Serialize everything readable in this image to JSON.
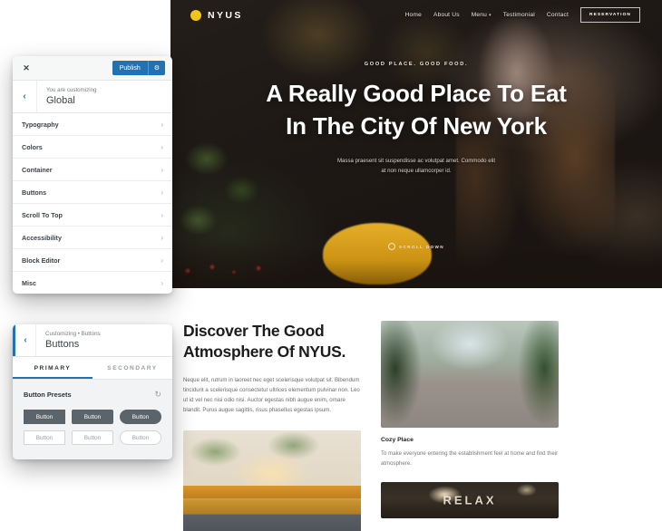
{
  "site": {
    "brand": {
      "name": "NYUS",
      "logo_icon": "circle-dot-icon",
      "logo_color": "#f0c419"
    },
    "nav": [
      {
        "label": "Home",
        "has_dropdown": false
      },
      {
        "label": "About Us",
        "has_dropdown": false
      },
      {
        "label": "Menu",
        "has_dropdown": true
      },
      {
        "label": "Testimonial",
        "has_dropdown": false
      },
      {
        "label": "Contact",
        "has_dropdown": false
      }
    ],
    "cta": {
      "label": "RESERVATION"
    },
    "hero": {
      "eyebrow": "GOOD PLACE. GOOD FOOD.",
      "title_line1": "A Really Good Place To Eat",
      "title_line2": "In The City Of New York",
      "subtitle_line1": "Massa praesent sit suspendisse ac volutpat amet. Commodo elit",
      "subtitle_line2": "at non neque ullamcorper id.",
      "scroll_label": "SCROLL DOWN",
      "scroll_icon": "mouse-scroll-icon"
    },
    "section": {
      "title_line1": "Discover The Good",
      "title_line2": "Atmosphere Of NYUS.",
      "body": "Neque elit, rutrum in laoreet nec eget scelerisque volutpat sit. Bibendum tincidunt a scelerisque consectetur ultrices elementum pulvinar non. Leo ut id vel nec nisi odio nisi. Auctor egestas nibh augue enim, ornare blandit. Purus augue sagittis, risus phasellus egestas ipsum.",
      "photo_left_alt": "restaurant-interior-photo"
    },
    "cards": [
      {
        "photo_alt": "outdoor-cafe-photo",
        "title": "Cozy Place",
        "body": "To make everyone entering the establishment feel at home and find their atmosphere."
      }
    ],
    "banner": {
      "word": "RELAX",
      "photo_alt": "relax-sign-photo"
    }
  },
  "customizer": {
    "close_icon": "close-icon",
    "publish_label": "Publish",
    "gear_icon": "gear-icon",
    "back_icon": "chevron-left-icon",
    "kicker": "You are customizing",
    "heading": "Global",
    "items": [
      {
        "label": "Typography"
      },
      {
        "label": "Colors"
      },
      {
        "label": "Container"
      },
      {
        "label": "Buttons"
      },
      {
        "label": "Scroll To Top"
      },
      {
        "label": "Accessibility"
      },
      {
        "label": "Block Editor"
      },
      {
        "label": "Misc"
      }
    ],
    "chevron_icon": "chevron-right-icon",
    "accent_color": "#2271b1"
  },
  "customizer_buttons": {
    "back_icon": "chevron-left-icon",
    "kicker": "Customizing • Buttons",
    "heading": "Buttons",
    "tabs": [
      {
        "label": "PRIMARY",
        "active": true
      },
      {
        "label": "SECONDARY",
        "active": false
      }
    ],
    "presets_title": "Button Presets",
    "reset_icon": "reset-icon",
    "presets": [
      {
        "label": "Button",
        "style": "filled",
        "radius": "r0"
      },
      {
        "label": "Button",
        "style": "filled",
        "radius": "r2"
      },
      {
        "label": "Button",
        "style": "filled",
        "radius": "rp"
      },
      {
        "label": "Button",
        "style": "outline",
        "radius": "r0"
      },
      {
        "label": "Button",
        "style": "outline",
        "radius": "r2"
      },
      {
        "label": "Button",
        "style": "outline",
        "radius": "rp"
      }
    ],
    "preset_fill_color": "#5b636b"
  }
}
